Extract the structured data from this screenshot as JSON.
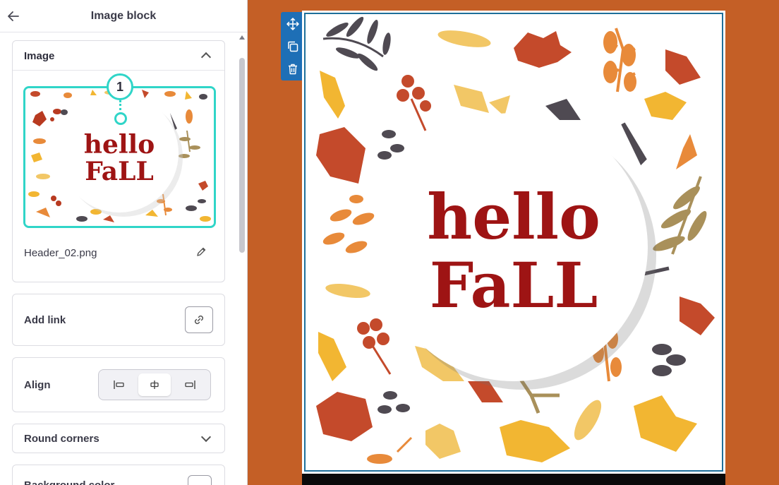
{
  "panel": {
    "title": "Image block",
    "back_icon": "arrow-left-icon"
  },
  "image_section": {
    "title": "Image",
    "filename": "Header_02.png",
    "marker": "1",
    "thumbnail_text_line1": "hello",
    "thumbnail_text_line2": "FaLL"
  },
  "link_section": {
    "label": "Add link",
    "icon": "link-icon"
  },
  "align_section": {
    "label": "Align",
    "options": [
      "align-left-icon",
      "align-center-icon",
      "align-right-icon"
    ],
    "selected": "center"
  },
  "round_corners": {
    "label": "Round corners"
  },
  "background_section": {
    "label": "Background color"
  },
  "canvas": {
    "headline_line1": "hello",
    "headline_line2": "FaLL",
    "background_color": "#c45f26",
    "accent_color": "#1e6fb6",
    "text_color": "#9e1414",
    "toolbar_icons": [
      "move-icon",
      "duplicate-icon",
      "delete-icon"
    ]
  }
}
